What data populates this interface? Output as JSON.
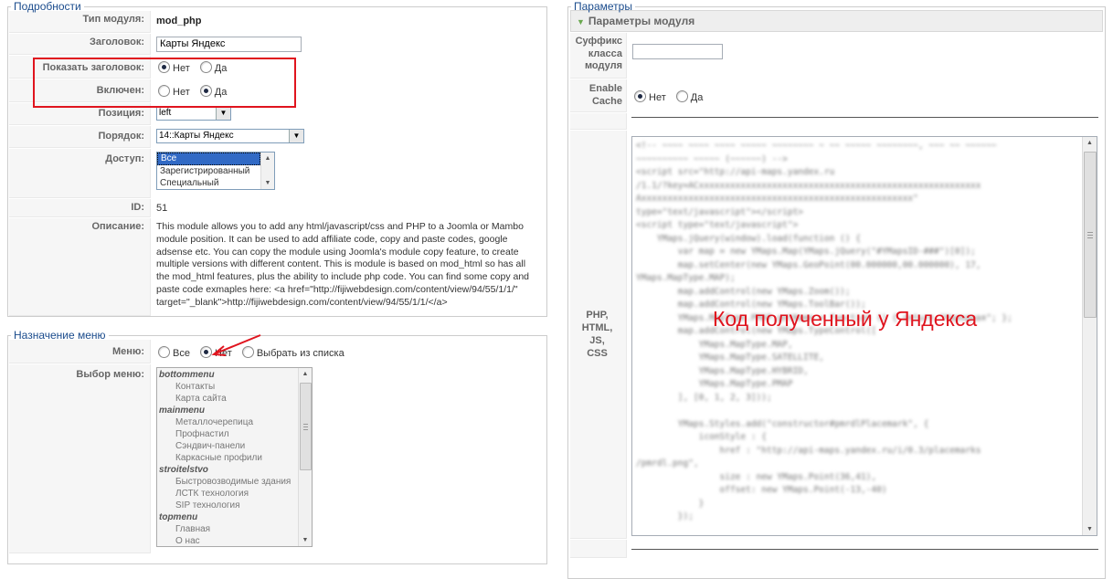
{
  "details": {
    "legend": "Подробности",
    "module_type_label": "Тип модуля:",
    "module_type_value": "mod_php",
    "title_label": "Заголовок:",
    "title_value": "Карты Яндекс",
    "show_title_label": "Показать заголовок:",
    "show_title_no": "Нет",
    "show_title_yes": "Да",
    "enabled_label": "Включен:",
    "enabled_no": "Нет",
    "enabled_yes": "Да",
    "position_label": "Позиция:",
    "position_value": "left",
    "order_label": "Порядок:",
    "order_value": "14::Карты Яндекс",
    "access_label": "Доступ:",
    "access_options": [
      "Все",
      "Зарегистрированный",
      "Специальный"
    ],
    "id_label": "ID:",
    "id_value": "51",
    "description_label": "Описание:",
    "description_lines": [
      "This module allows you to add any html/javascript/css and PHP to a Joomla or Mambo",
      "module position. It can be used to add affiliate code, copy and paste codes, google",
      "adsense etc. You can copy the module using Joomla's module copy feature, to create",
      "multiple versions with different content. This is module is based on mod_html so has all",
      "the mod_html features, plus the ability to include php code. You can find some copy and",
      "paste code exmaples here: <a href=\"http://fijiwebdesign.com/content/view/94/55/1/1/\"",
      "target=\"_blank\">http://fijiwebdesign.com/content/view/94/55/1/1/</a>"
    ]
  },
  "menu_assignment": {
    "legend": "Назначение меню",
    "menus_label": "Меню:",
    "opt_all": "Все",
    "opt_none": "Нет",
    "opt_select": "Выбрать из списка",
    "menu_selection_label": "Выбор меню:",
    "list": [
      {
        "text": "bottommenu",
        "group": true
      },
      {
        "text": "Контакты",
        "group": false
      },
      {
        "text": "Карта сайта",
        "group": false
      },
      {
        "text": "mainmenu",
        "group": true
      },
      {
        "text": "Металлочерепица",
        "group": false
      },
      {
        "text": "Профнастил",
        "group": false
      },
      {
        "text": "Сэндвич-панели",
        "group": false
      },
      {
        "text": "Каркасные профили",
        "group": false
      },
      {
        "text": "stroitelstvo",
        "group": true
      },
      {
        "text": "Быстровозводимые здания",
        "group": false
      },
      {
        "text": "ЛСТК технология",
        "group": false
      },
      {
        "text": "SIP технология",
        "group": false
      },
      {
        "text": "topmenu",
        "group": true
      },
      {
        "text": "Главная",
        "group": false
      },
      {
        "text": "О нас",
        "group": false
      }
    ]
  },
  "params": {
    "legend": "Параметры",
    "panel_title": "Параметры модуля",
    "suffix_label_lines": [
      "Суффикс",
      "класса",
      "модуля"
    ],
    "suffix_value": "",
    "cache_label_lines": [
      "Enable",
      "Cache"
    ],
    "cache_no": "Нет",
    "cache_yes": "Да",
    "code_label_lines": [
      "PHP,",
      "HTML, JS,",
      "CSS"
    ],
    "annotation": "Код полученный у Яндекса"
  },
  "colors": {
    "highlight_box": "#e0141e",
    "annotation": "#e0141e",
    "legend": "#1a4b8c",
    "selected": "#316ac5"
  }
}
